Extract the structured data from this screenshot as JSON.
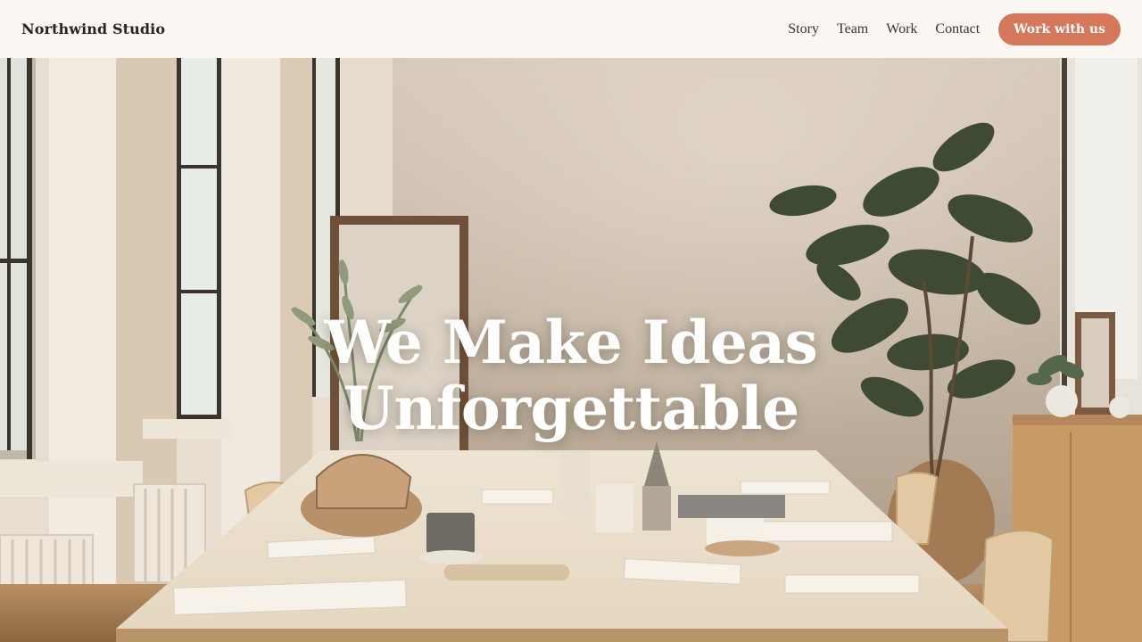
{
  "nav": {
    "brand": "Northwind Studio",
    "links": [
      "Story",
      "Team",
      "Work",
      "Contact"
    ],
    "cta_label": "Work with us"
  },
  "hero": {
    "headline_line1": "We Make Ideas",
    "headline_line2": "Unforgettable",
    "background_image": "bright studio office with long shared table, plants and tall windows"
  },
  "colors": {
    "nav_background": "#faf7f3",
    "accent": "#d4775a",
    "brand_text": "#2b2520",
    "headline_text": "#ffffff"
  }
}
